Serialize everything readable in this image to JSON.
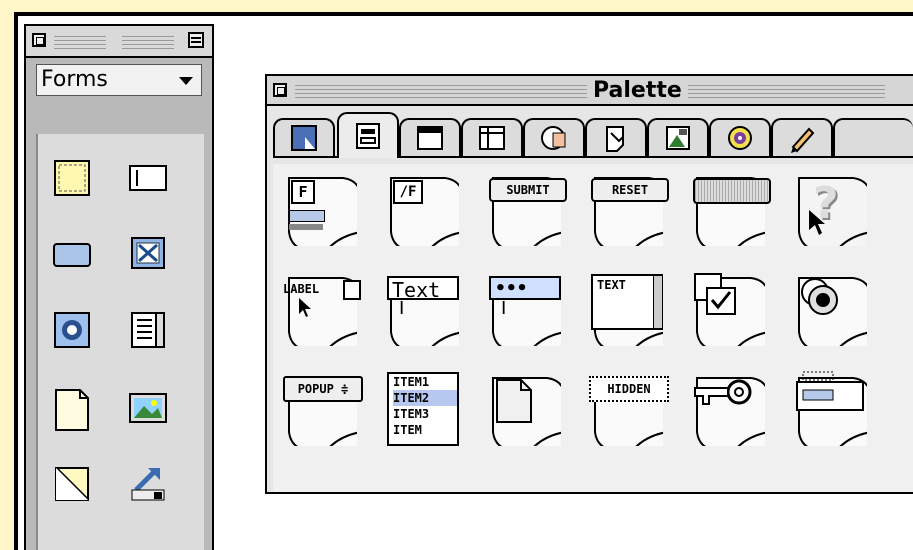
{
  "tools_window": {
    "category": "Forms",
    "tools": [
      "form-area-tool",
      "text-field-tool",
      "button-tool",
      "checkbox-tool",
      "radio-button-tool",
      "scrolling-list-tool",
      "blank-page-tool",
      "image-tool",
      "diagonal-line-tool",
      "link-arrow-tool"
    ]
  },
  "palette": {
    "title": "Palette",
    "tabs": [
      "cursor-tab",
      "form-elements-tab",
      "window-tab",
      "frames-tab",
      "disk-tab",
      "document-tab",
      "image-tab",
      "media-tab",
      "pencil-tab"
    ],
    "active_tab": 1,
    "items": {
      "row1": {
        "form_start": "F",
        "form_end": "/F",
        "submit": "SUBMIT",
        "reset": "RESET",
        "help": "?"
      },
      "row2": {
        "label": "LABEL",
        "text": "Text",
        "password": "•••",
        "textarea": "TEXT"
      },
      "row3": {
        "popup": "POPUP ≑",
        "list": [
          "ITEM1",
          "ITEM2",
          "ITEM3",
          "ITEM"
        ],
        "hidden": "HIDDEN"
      }
    }
  }
}
